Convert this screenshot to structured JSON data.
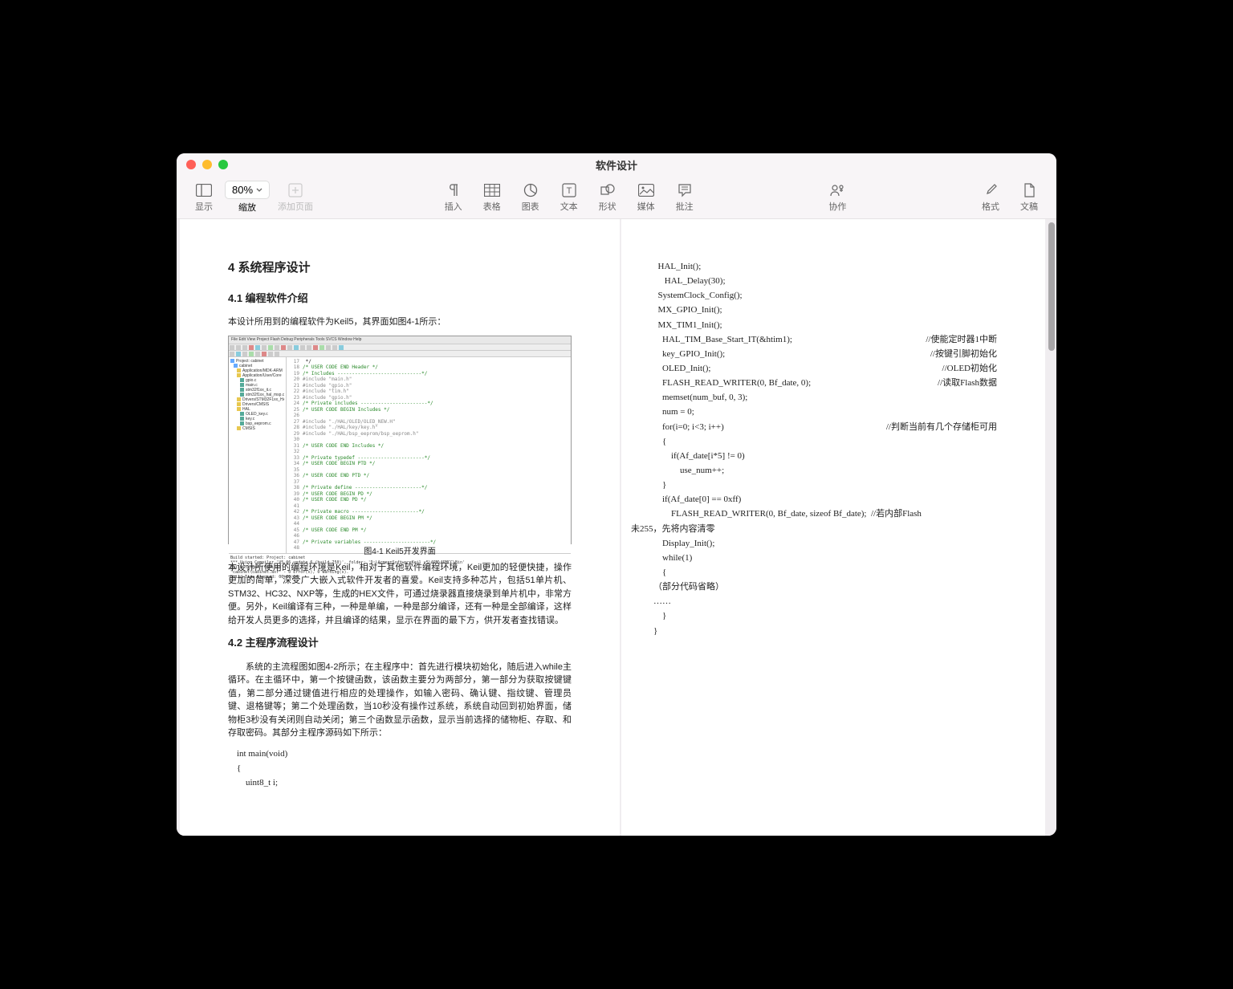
{
  "window": {
    "title": "软件设计"
  },
  "toolbar": {
    "view_label": "显示",
    "zoom_value": "80%",
    "zoom_label": "缩放",
    "add_page_label": "添加页面",
    "insert_label": "插入",
    "table_label": "表格",
    "chart_label": "图表",
    "text_label": "文本",
    "shape_label": "形状",
    "media_label": "媒体",
    "comment_label": "批注",
    "collab_label": "协作",
    "format_label": "格式",
    "document_label": "文稿"
  },
  "doc": {
    "h2": "4 系统程序设计",
    "h3_1": "4.1 编程软件介绍",
    "p1": "本设计所用到的编程软件为Keil5，其界面如图4-1所示：",
    "caption1": "图4-1 Keil5开发界面",
    "p2": "本设计所使用的编程环境是Keil，相对于其他软件编程环境，Keil更加的轻便快捷，操作更加的简单，深受广大嵌入式软件开发者的喜爱。Keil支持多种芯片，包括51单片机、STM32、HC32、NXP等，生成的HEX文件，可通过烧录器直接烧录到单片机中，非常方便。另外，Keil编译有三种，一种是单编，一种是部分编译，还有一种是全部编译，这样给开发人员更多的选择，并且编译的结果，显示在界面的最下方，供开发者查找错误。",
    "h3_2": "4.2 主程序流程设计",
    "p3": "系统的主流程图如图4-2所示；在主程序中：首先进行模块初始化，随后进入while主循环。在主循环中，第一个按键函数，该函数主要分为两部分，第一部分为获取按键键值，第二部分通过键值进行相应的处理操作，如输入密码、确认键、指纹键、管理员键、退格键等；第二个处理函数，当10秒没有操作过系统，系统自动回到初始界面，储物柜3秒没有关闭则自动关闭；第三个函数显示函数，显示当前选择的储物柜、存取、和存取密码。其部分主程序源码如下所示：",
    "code_left": [
      "int main(void)",
      "{",
      "    uint8_t i;"
    ],
    "code_right": [
      {
        "t": "  HAL_Init();",
        "c": ""
      },
      {
        "t": "     HAL_Delay(30);",
        "c": ""
      },
      {
        "t": "  SystemClock_Config();",
        "c": ""
      },
      {
        "t": "  MX_GPIO_Init();",
        "c": ""
      },
      {
        "t": "  MX_TIM1_Init();",
        "c": ""
      },
      {
        "t": "    HAL_TIM_Base_Start_IT(&htim1);",
        "c": "//使能定时器1中断"
      },
      {
        "t": "    key_GPIO_Init();",
        "c": "//按键引脚初始化"
      },
      {
        "t": "    OLED_Init();",
        "c": "//OLED初始化"
      },
      {
        "t": "    FLASH_READ_WRITER(0, Bf_date, 0);",
        "c": "//读取Flash数据"
      },
      {
        "t": "    memset(num_buf, 0, 3);",
        "c": ""
      },
      {
        "t": "    num = 0;",
        "c": ""
      },
      {
        "t": "    for(i=0; i<3; i++)",
        "c": "//判断当前有几个存储柜可用"
      },
      {
        "t": "    {",
        "c": ""
      },
      {
        "t": "        if(Af_date[i*5] != 0)",
        "c": ""
      },
      {
        "t": "            use_num++;",
        "c": ""
      },
      {
        "t": "    }",
        "c": ""
      },
      {
        "t": "",
        "c": ""
      },
      {
        "t": "    if(Af_date[0] == 0xff)",
        "c": ""
      },
      {
        "t": "        FLASH_READ_WRITER(0, Bf_date, sizeof Bf_date);  //若内部Flash",
        "c": ""
      }
    ],
    "code_right_wrap": "未255，先将内容清零",
    "code_right_2": [
      "    Display_Init();",
      "",
      "    while(1)",
      "    {",
      "（部分代码省略）",
      "……",
      "    }",
      "}"
    ],
    "keil": {
      "menu": "File  Edit  View  Project  Flash  Debug  Peripherals  Tools  SVCS  Window  Help",
      "tree": [
        "Project: cabinet",
        "  cabinet",
        "    Application/MDK-ARM",
        "    Application/User/Core",
        "      gpio.c",
        "      main.c",
        "      stm32f1xx_it.c",
        "      stm32f1xx_hal_msp.c",
        "    Drivers/STM32F1xx_HAL_Drv",
        "    Drivers/CMSIS",
        "    HAL",
        "      OLED_key.c",
        "      key.c",
        "      bsp_eeprom.c",
        "    CMSIS"
      ],
      "code": [
        {
          "n": "17",
          "t": " */"
        },
        {
          "n": "18",
          "t": "/* USER CODE END Header */",
          "cls": "cm"
        },
        {
          "n": "19",
          "t": "/* Includes -----------------------------*/",
          "cls": "cm"
        },
        {
          "n": "20",
          "t": "#include \"main.h\"",
          "cls": "pp"
        },
        {
          "n": "21",
          "t": "#include \"gpio.h\"",
          "cls": "pp"
        },
        {
          "n": "22",
          "t": "#include \"tim.h\"",
          "cls": "pp"
        },
        {
          "n": "23",
          "t": "#include \"gpio.h\"",
          "cls": "pp"
        },
        {
          "n": "24",
          "t": "/* Private includes -----------------------*/",
          "cls": "cm"
        },
        {
          "n": "25",
          "t": "/* USER CODE BEGIN Includes */",
          "cls": "cm"
        },
        {
          "n": "26",
          "t": ""
        },
        {
          "n": "27",
          "t": "#include \"./HAL/OLED/OLED_NEW.H\"",
          "cls": "pp"
        },
        {
          "n": "28",
          "t": "#include \"./HAL/key/key.h\"",
          "cls": "pp"
        },
        {
          "n": "29",
          "t": "#include \"./HAL/bsp_eeprom/bsp_eeprom.h\"",
          "cls": "pp"
        },
        {
          "n": "30",
          "t": ""
        },
        {
          "n": "31",
          "t": "/* USER CODE END Includes */",
          "cls": "cm"
        },
        {
          "n": "32",
          "t": ""
        },
        {
          "n": "33",
          "t": "/* Private typedef -----------------------*/",
          "cls": "cm"
        },
        {
          "n": "34",
          "t": "/* USER CODE BEGIN PTD */",
          "cls": "cm"
        },
        {
          "n": "35",
          "t": ""
        },
        {
          "n": "36",
          "t": "/* USER CODE END PTD */",
          "cls": "cm"
        },
        {
          "n": "37",
          "t": ""
        },
        {
          "n": "38",
          "t": "/* Private define -----------------------*/",
          "cls": "cm"
        },
        {
          "n": "39",
          "t": "/* USER CODE BEGIN PD */",
          "cls": "cm"
        },
        {
          "n": "40",
          "t": "/* USER CODE END PD */",
          "cls": "cm"
        },
        {
          "n": "41",
          "t": ""
        },
        {
          "n": "42",
          "t": "/* Private macro -----------------------*/",
          "cls": "cm"
        },
        {
          "n": "43",
          "t": "/* USER CODE BEGIN PM */",
          "cls": "cm"
        },
        {
          "n": "44",
          "t": ""
        },
        {
          "n": "45",
          "t": "/* USER CODE END PM */",
          "cls": "cm"
        },
        {
          "n": "46",
          "t": ""
        },
        {
          "n": "47",
          "t": "/* Private variables -----------------------*/",
          "cls": "cm"
        },
        {
          "n": "48",
          "t": ""
        }
      ],
      "output": [
        "Build started: Project: cabinet",
        "*** Using Compiler 'V5.06 update 6 (build 750)', folder: 'D:\\ArmeenSoftwareKeil_v5\\ARM\\ARMCC\\Bin'",
        "Build target 'cabinet'",
        "\"cabinet\\cabinet.axf\" - 0 Error(s), 0 Warning(s).",
        "Build Time Elapsed:  00:00:14"
      ]
    }
  }
}
